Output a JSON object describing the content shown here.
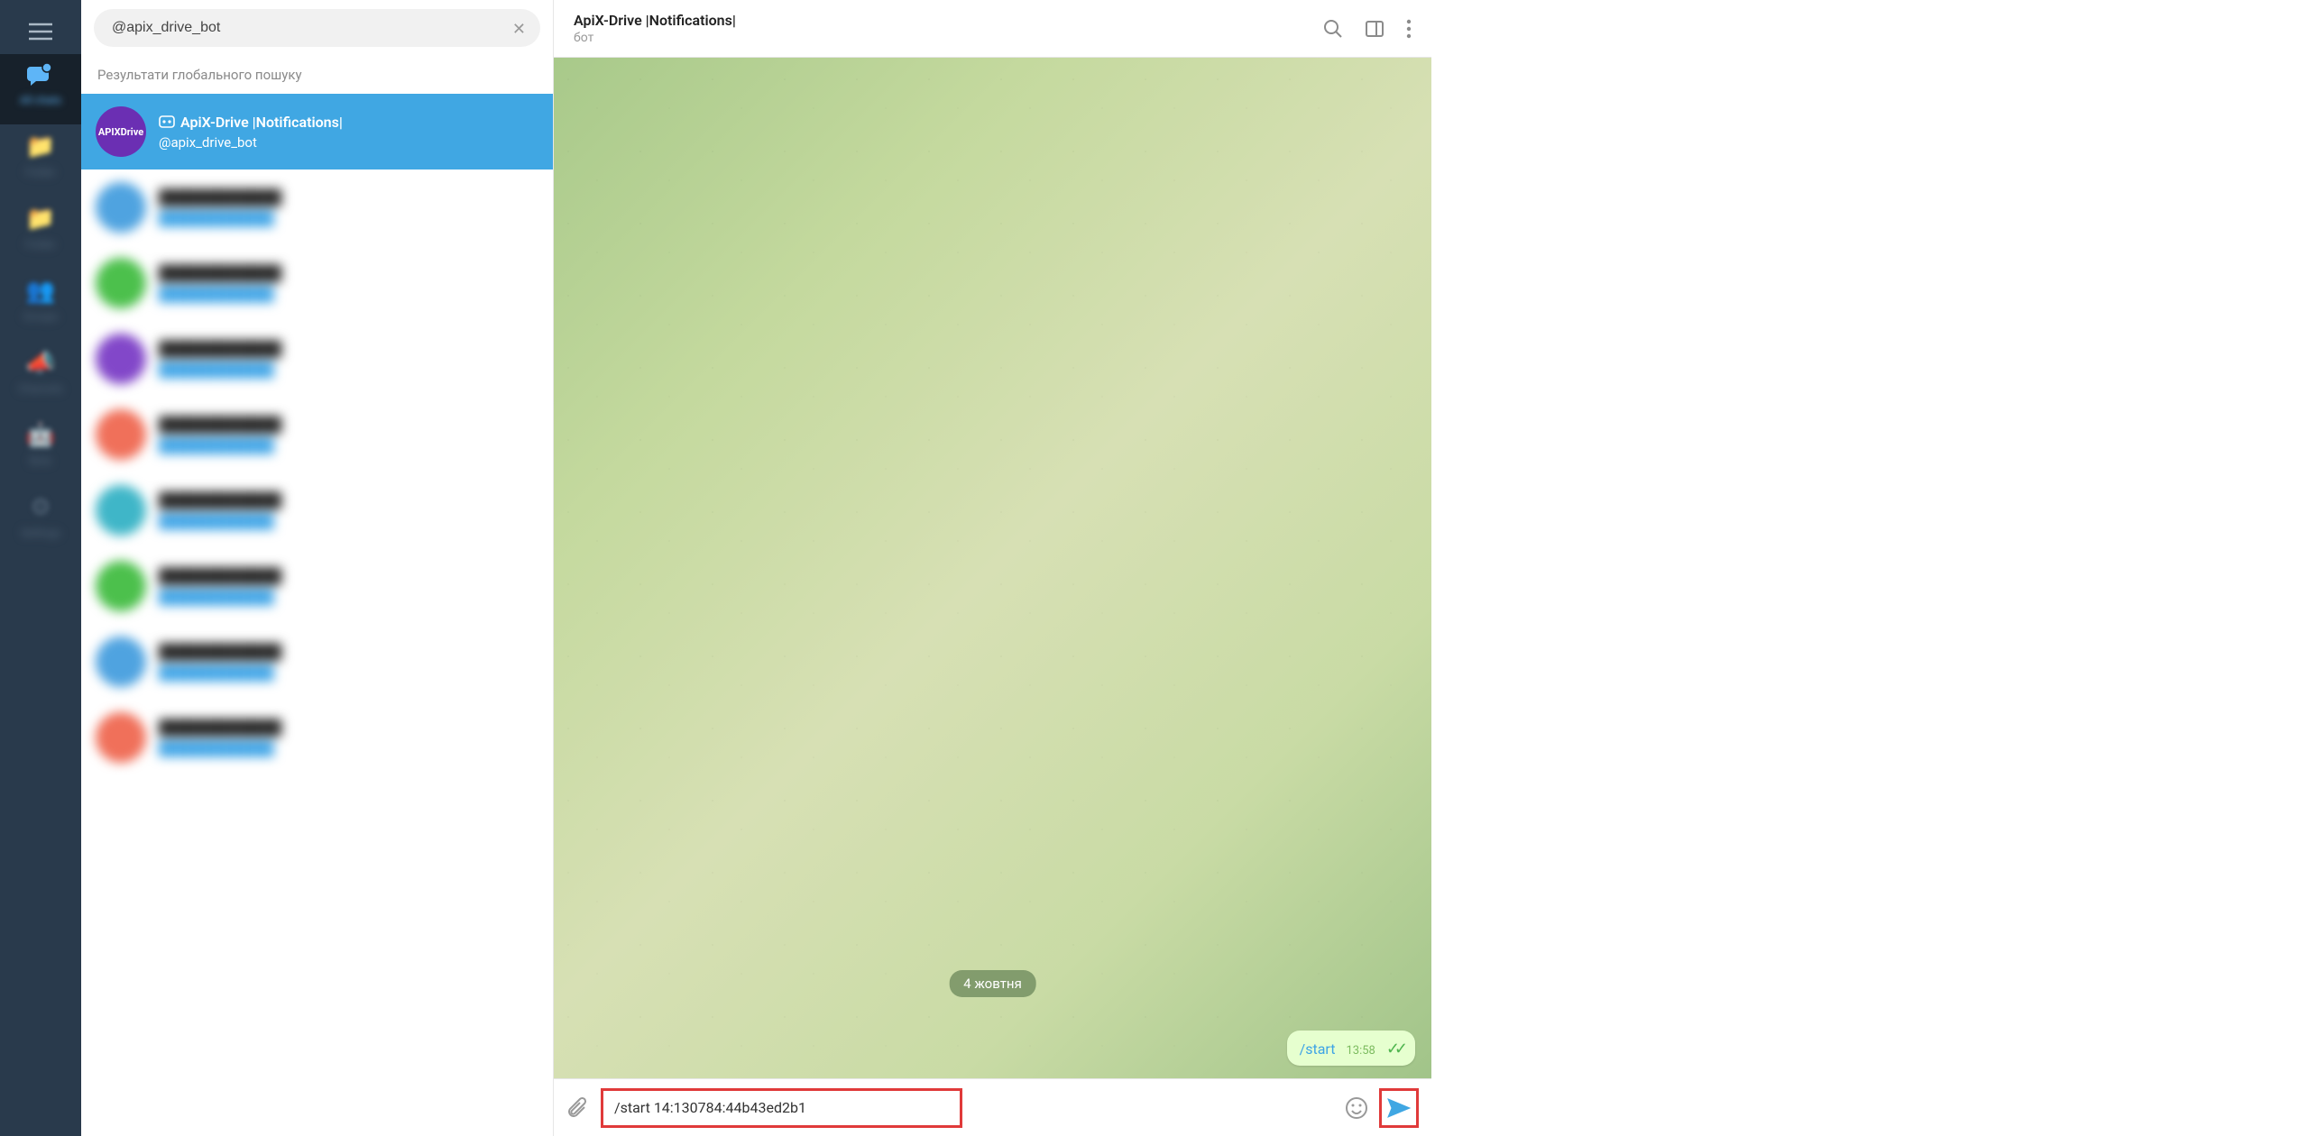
{
  "rail": {
    "items": [
      {
        "icon": "chat",
        "label": "All chats"
      },
      {
        "icon": "folder",
        "label": "Folder"
      },
      {
        "icon": "folder",
        "label": "Folder"
      },
      {
        "icon": "people",
        "label": "Groups"
      },
      {
        "icon": "megaphone",
        "label": "Channels"
      },
      {
        "icon": "bot",
        "label": "Bots"
      },
      {
        "icon": "settings",
        "label": "Settings"
      }
    ]
  },
  "search": {
    "value": "@apix_drive_bot"
  },
  "section_label": "Результати глобального пошуку",
  "results": {
    "selected": {
      "avatar_text": "APIXDrive",
      "title": "ApiX-Drive |Notifications|",
      "subtitle": "@apix_drive_bot"
    },
    "others": [
      {
        "color": "c-blue"
      },
      {
        "color": "c-green"
      },
      {
        "color": "c-purple"
      },
      {
        "color": "c-orange"
      },
      {
        "color": "c-teal"
      },
      {
        "color": "c-green"
      },
      {
        "color": "c-blue"
      },
      {
        "color": "c-orange"
      }
    ]
  },
  "chat": {
    "header_title": "ApiX-Drive |Notifications|",
    "header_subtitle": "бот",
    "date_chip": "4 жовтня",
    "sent_msg": {
      "text": "/start",
      "time": "13:58"
    },
    "composer_value": "/start 14:130784:44b43ed2b1"
  }
}
